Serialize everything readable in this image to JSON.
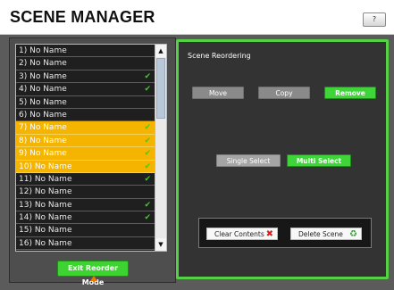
{
  "header": {
    "title": "SCENE MANAGER",
    "help_label": "?"
  },
  "scene_list": {
    "items": [
      {
        "label": "1) No Name",
        "selected": false,
        "checked": false
      },
      {
        "label": "2) No Name",
        "selected": false,
        "checked": false
      },
      {
        "label": "3) No Name",
        "selected": false,
        "checked": true
      },
      {
        "label": "4) No Name",
        "selected": false,
        "checked": true
      },
      {
        "label": "5) No Name",
        "selected": false,
        "checked": false
      },
      {
        "label": "6) No Name",
        "selected": false,
        "checked": false
      },
      {
        "label": "7) No Name",
        "selected": true,
        "checked": true
      },
      {
        "label": "8) No Name",
        "selected": true,
        "checked": true
      },
      {
        "label": "9) No Name",
        "selected": true,
        "checked": true
      },
      {
        "label": "10) No Name",
        "selected": true,
        "checked": true
      },
      {
        "label": "11) No Name",
        "selected": false,
        "checked": true
      },
      {
        "label": "12) No Name",
        "selected": false,
        "checked": false
      },
      {
        "label": "13) No Name",
        "selected": false,
        "checked": true
      },
      {
        "label": "14) No Name",
        "selected": false,
        "checked": true
      },
      {
        "label": "15) No Name",
        "selected": false,
        "checked": false
      },
      {
        "label": "16) No Name",
        "selected": false,
        "checked": false
      }
    ],
    "check_icon": "checkmark-icon"
  },
  "left_actions": {
    "exit_label": "Exit Reorder Mode"
  },
  "reordering": {
    "section_label": "Scene Reordering",
    "move_label": "Move",
    "copy_label": "Copy",
    "remove_label": "Remove",
    "single_select_label": "Single Select",
    "multi_select_label": "Multi Select",
    "clear_contents_label": "Clear Contents",
    "delete_scene_label": "Delete Scene"
  },
  "colors": {
    "accent_green": "#3fd53a",
    "selected_row": "#f5b400",
    "panel_border": "#55d146"
  }
}
